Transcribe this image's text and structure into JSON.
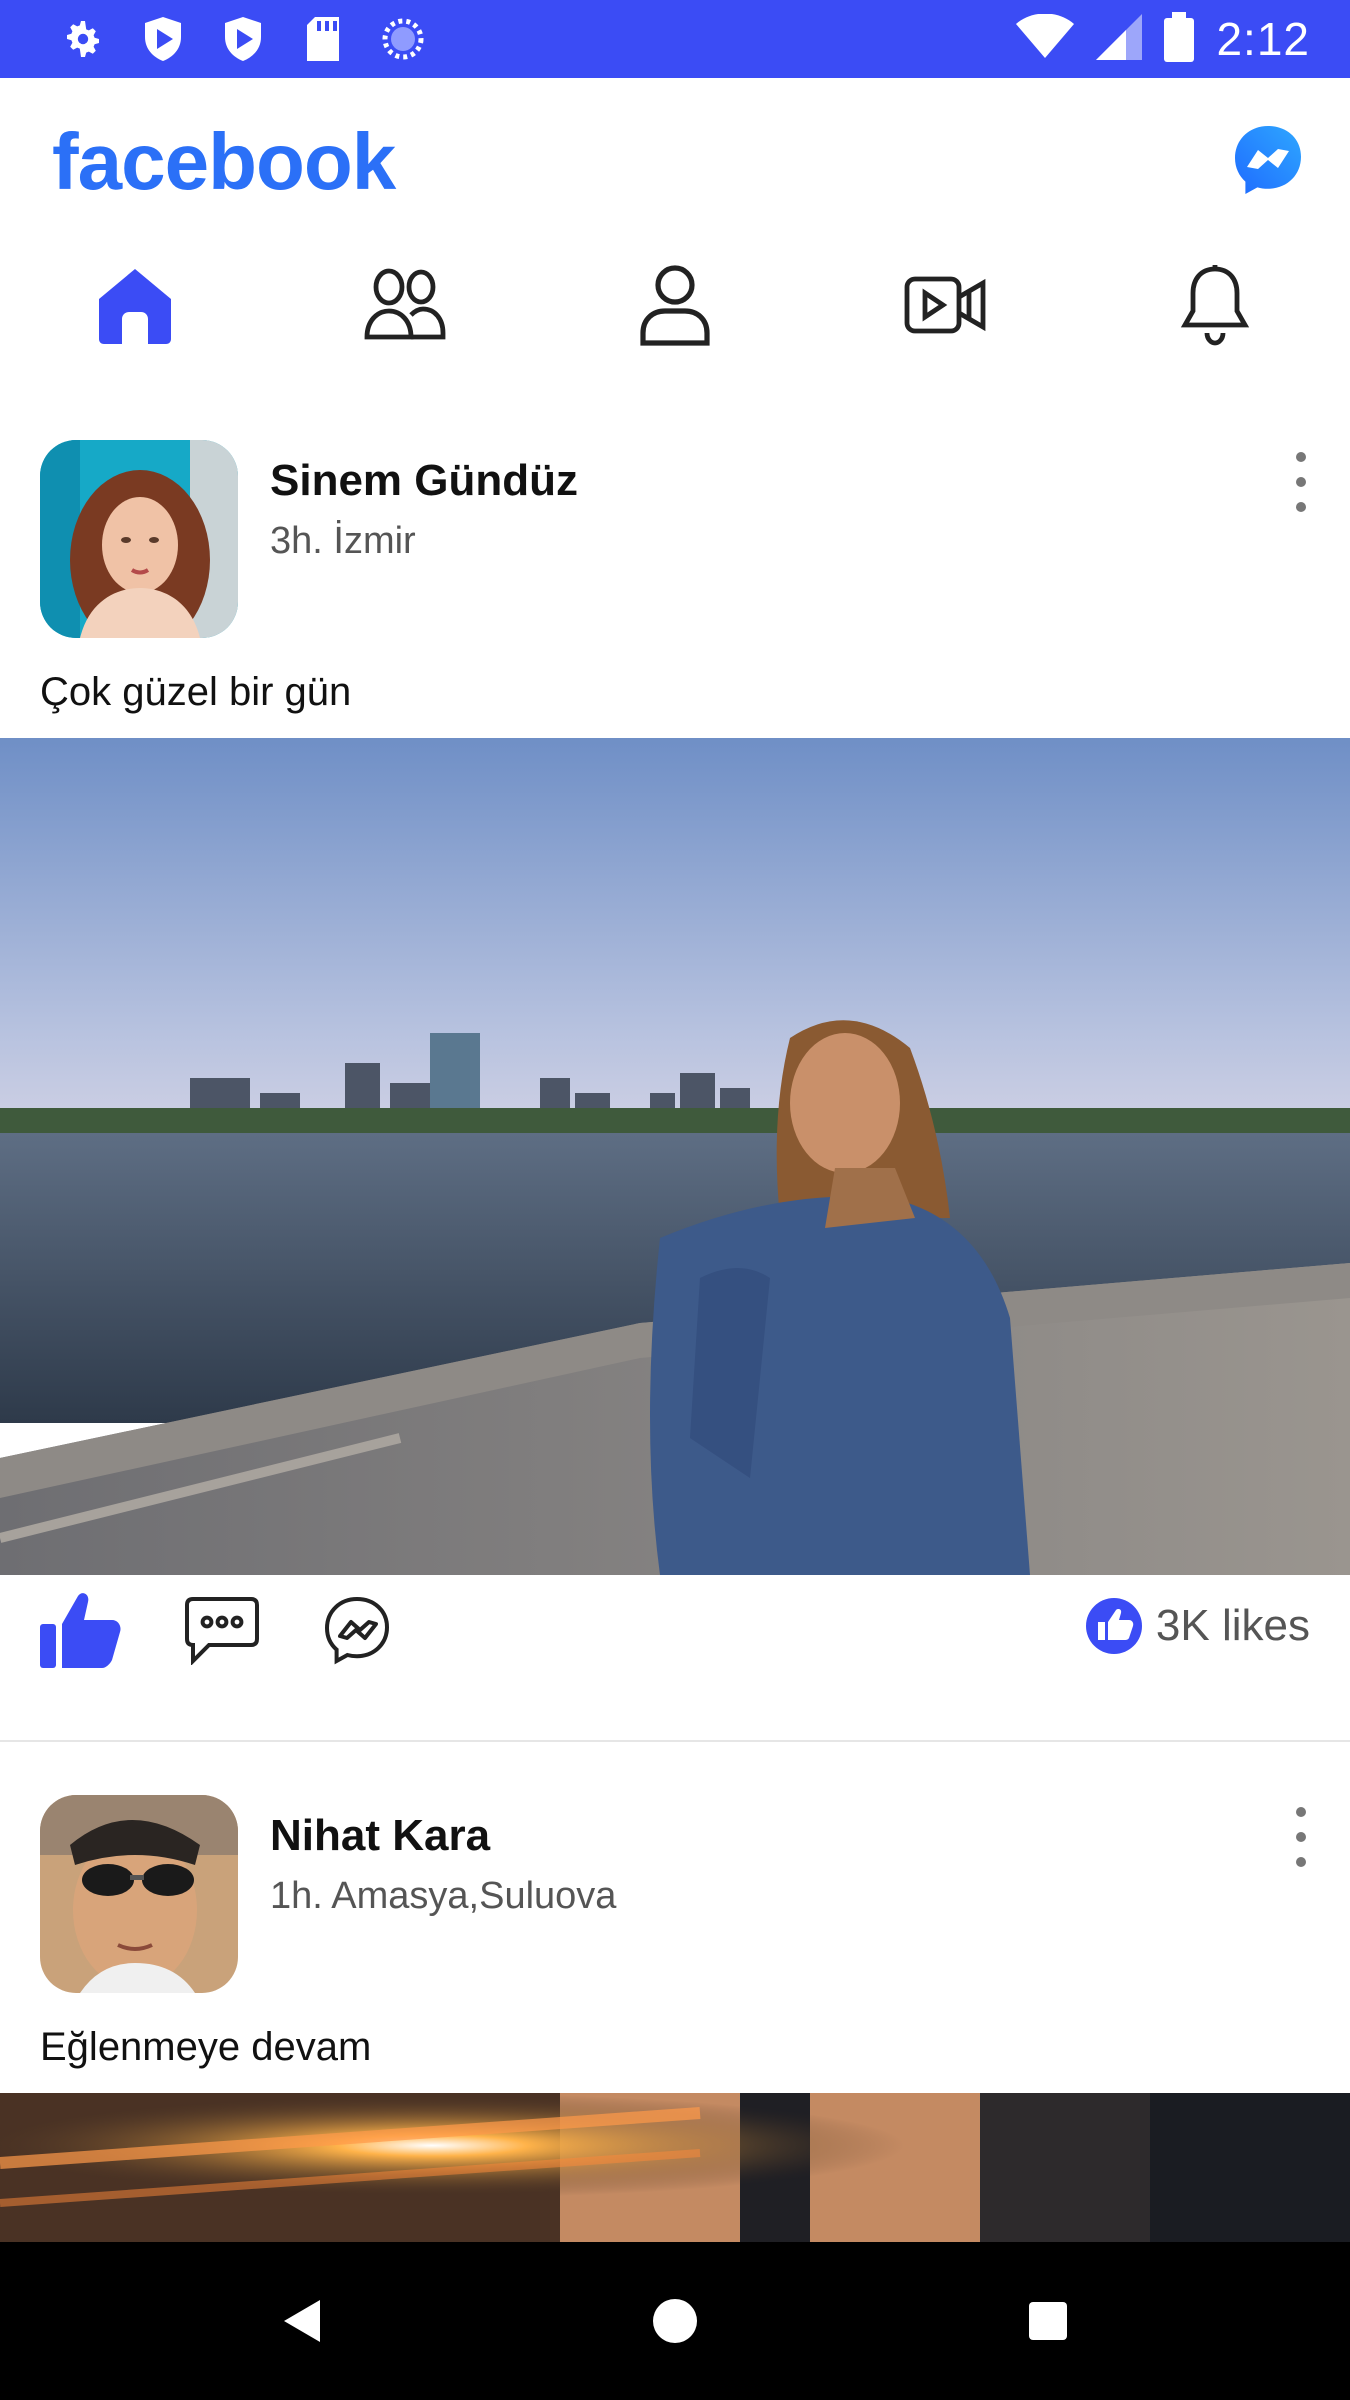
{
  "status_bar": {
    "time": "2:12",
    "left_icons": [
      "settings-icon",
      "shield-play-icon",
      "shield-play-icon",
      "sd-card-icon",
      "loading-icon"
    ],
    "right_icons": [
      "wifi-icon",
      "signal-icon",
      "battery-icon"
    ]
  },
  "header": {
    "brand": "facebook",
    "brand_color": "#2b70f7",
    "messenger_icon": "messenger-icon"
  },
  "tabs": [
    {
      "name": "home",
      "icon": "home-icon",
      "active": true
    },
    {
      "name": "friends",
      "icon": "friends-icon",
      "active": false
    },
    {
      "name": "profile",
      "icon": "profile-icon",
      "active": false
    },
    {
      "name": "watch",
      "icon": "video-icon",
      "active": false
    },
    {
      "name": "notifications",
      "icon": "bell-icon",
      "active": false
    }
  ],
  "accent_color": "#3b4cf5",
  "posts": [
    {
      "author": "Sinem Gündüz",
      "meta": "3h. İzmir",
      "caption": "Çok güzel bir gün",
      "likes": "3K likes"
    },
    {
      "author": "Nihat Kara",
      "meta": "1h. Amasya,Suluova",
      "caption": "Eğlenmeye devam"
    }
  ],
  "nav_bar": {
    "buttons": [
      "back-icon",
      "home-circle-icon",
      "recents-icon"
    ]
  }
}
